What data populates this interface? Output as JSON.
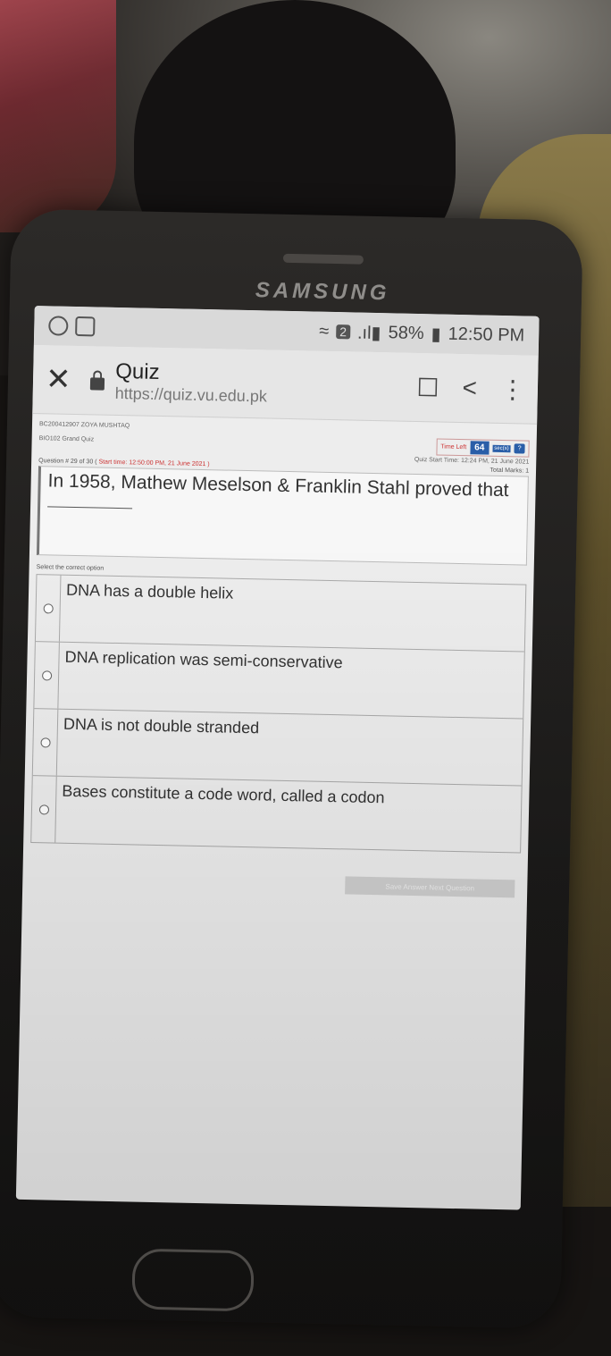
{
  "phone": {
    "brand": "SAMSUNG"
  },
  "status_bar": {
    "sim_badge": "2",
    "battery": "58%",
    "time": "12:50 PM"
  },
  "browser": {
    "title": "Quiz",
    "url": "https://quiz.vu.edu.pk",
    "icons": [
      "close-icon",
      "lock-icon",
      "bookmark-icon",
      "share-icon",
      "more-icon"
    ]
  },
  "quiz": {
    "student": "BC200412907 ZOYA MUSHTAQ",
    "course": "BIO102 Grand Quiz",
    "timer_label": "Time Left",
    "timer_value": "64",
    "timer_unit": "sec(s)",
    "timer_help": "?",
    "start_time": "Quiz Start Time: 12:24 PM, 21 June 2021",
    "question_number": "Question # 29 of 30 (",
    "question_start": "Start time: 12:50:00 PM, 21 June 2021 )",
    "total_marks": "Total Marks: 1",
    "question_text": "In 1958, Mathew Meselson & Franklin Stahl proved that",
    "select_label": "Select the correct option",
    "options": [
      "DNA has a double helix",
      "DNA replication was semi-conservative",
      "DNA is not double stranded",
      "Bases constitute a code word, called a codon"
    ],
    "save_button": "Save Answer Next Question"
  }
}
